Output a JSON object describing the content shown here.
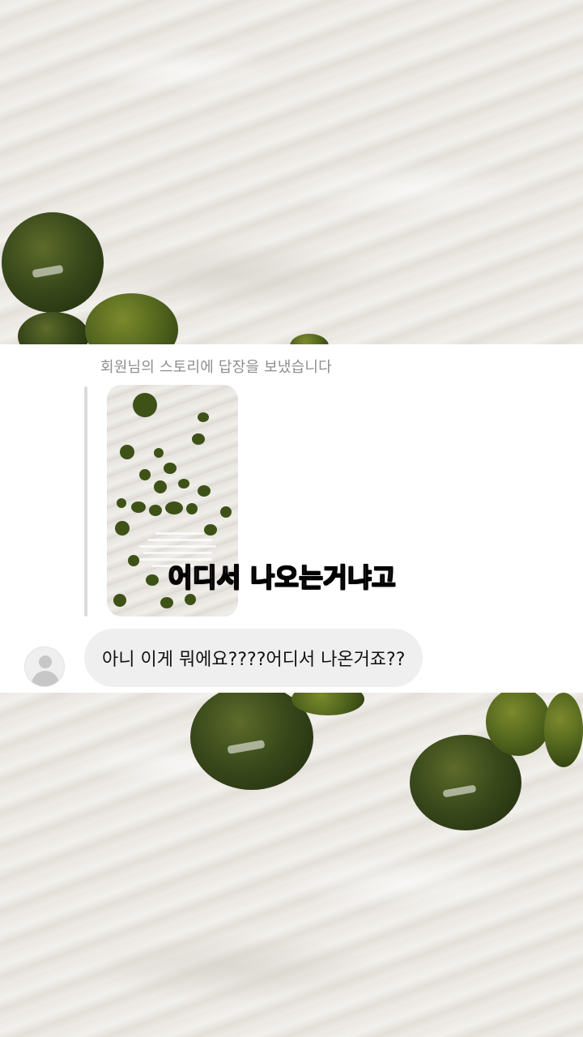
{
  "story_reply": {
    "caption": "회원님의 스토리에 답장을 보냈습니다",
    "thumbnail_icon": "story-thumbnail-image"
  },
  "overlay_text": "어디서 나오는거냐고",
  "message": {
    "text": "아니 이게 뭐에요????어디서 나온거죠??",
    "avatar_icon": "default-avatar-icon",
    "bubble_color": "#efefef"
  },
  "colors": {
    "caption": "#8e8e8e",
    "panel_background": "#ffffff",
    "seed_green": "#3a4a1b"
  }
}
